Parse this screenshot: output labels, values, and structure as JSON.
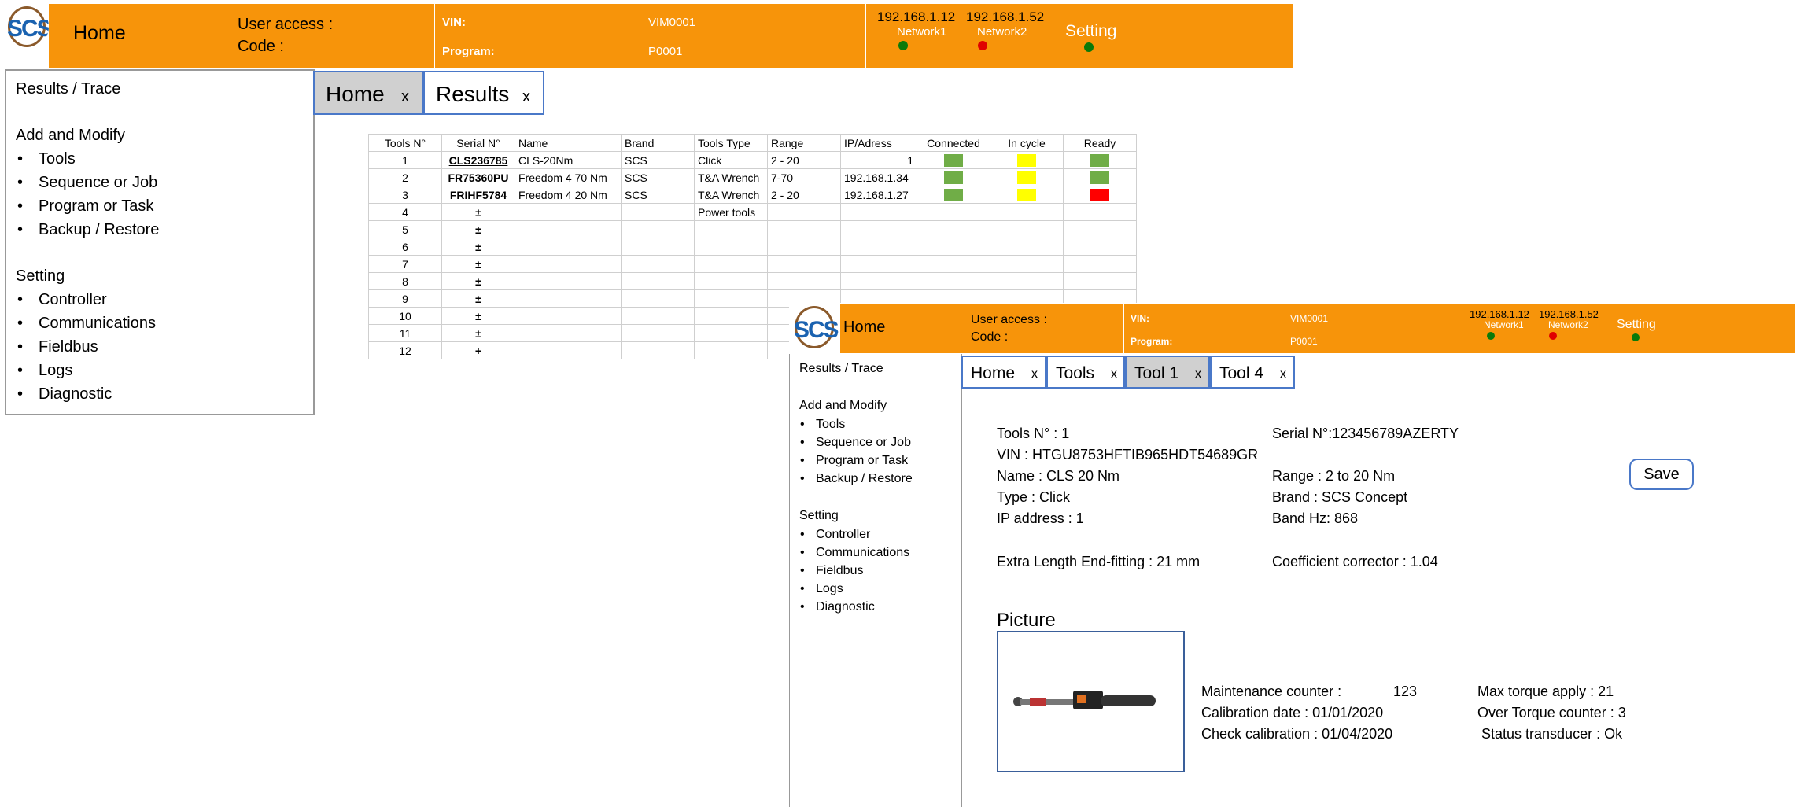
{
  "colors": {
    "header": "#F7940A",
    "green": "#70AD47",
    "yellow": "#FFFF00",
    "red": "#FF0000",
    "tab_border": "#4a78c8"
  },
  "main": {
    "logo_text": "SCS",
    "header": {
      "home": "Home",
      "user_access": "User access :",
      "code": "Code :",
      "vin_label": "VIN:",
      "vin_value": "VIM0001",
      "program_label": "Program:",
      "program_value": "P0001",
      "ip1": "192.168.1.12",
      "ip2": "192.168.1.52",
      "network1": "Network1",
      "network2": "Network2",
      "setting": "Setting"
    },
    "sidebar": {
      "results": "Results / Trace",
      "add_modify": "Add and Modify",
      "add_items": [
        "Tools",
        "Sequence or Job",
        "Program or Task",
        "Backup / Restore"
      ],
      "setting": "Setting",
      "setting_items": [
        "Controller",
        "Communications",
        "Fieldbus",
        "Logs",
        "Diagnostic"
      ]
    },
    "tabs": [
      {
        "label": "Home",
        "close": "x"
      },
      {
        "label": "Results",
        "close": "x"
      }
    ],
    "table": {
      "headers": [
        "Tools N°",
        "Serial N°",
        "Name",
        "Brand",
        "Tools Type",
        "Range",
        "IP/Adress",
        "Connected",
        "In cycle",
        "Ready"
      ],
      "rows": [
        {
          "no": "1",
          "serial": "CLS236785",
          "name": "CLS-20Nm",
          "brand": "SCS",
          "type": "Click",
          "range": "2 - 20",
          "ip": "1",
          "status": [
            "green",
            "yellow",
            "green"
          ]
        },
        {
          "no": "2",
          "serial": "FR75360PU",
          "name": "Freedom 4 70 Nm",
          "brand": "SCS",
          "type": "T&A Wrench",
          "range": "7-70",
          "ip": "192.168.1.34",
          "status": [
            "green",
            "yellow",
            "green"
          ]
        },
        {
          "no": "3",
          "serial": "FRIHF5784",
          "name": "Freedom 4 20 Nm",
          "brand": "SCS",
          "type": "T&A Wrench",
          "range": "2 - 20",
          "ip": "192.168.1.27",
          "status": [
            "green",
            "yellow",
            "red"
          ]
        }
      ],
      "empty_rows": [
        {
          "no": "4",
          "add": "±",
          "extra": "Power tools"
        },
        {
          "no": "5",
          "add": "±"
        },
        {
          "no": "6",
          "add": "±"
        },
        {
          "no": "7",
          "add": "±"
        },
        {
          "no": "8",
          "add": "±"
        },
        {
          "no": "9",
          "add": "±"
        },
        {
          "no": "10",
          "add": "±"
        },
        {
          "no": "11",
          "add": "±"
        },
        {
          "no": "12",
          "add": "+"
        }
      ]
    }
  },
  "detail": {
    "logo_text": "SCS",
    "header": {
      "home": "Home",
      "user_access": "User access :",
      "code": "Code :",
      "vin_label": "VIN:",
      "vin_value": "VIM0001",
      "program_label": "Program:",
      "program_value": "P0001",
      "ip1": "192.168.1.12",
      "ip2": "192.168.1.52",
      "network1": "Network1",
      "network2": "Network2",
      "setting": "Setting"
    },
    "sidebar": {
      "results": "Results / Trace",
      "add_modify": "Add and Modify",
      "add_items": [
        "Tools",
        "Sequence or Job",
        "Program or Task",
        "Backup / Restore"
      ],
      "setting": "Setting",
      "setting_items": [
        "Controller",
        "Communications",
        "Fieldbus",
        "Logs",
        "Diagnostic"
      ]
    },
    "tabs": [
      {
        "label": "Home",
        "close": "x"
      },
      {
        "label": "Tools",
        "close": "x"
      },
      {
        "label": "Tool 1",
        "close": "x"
      },
      {
        "label": "Tool 4",
        "close": "x"
      }
    ],
    "info": {
      "tools_no": "Tools N° : 1",
      "serial": "Serial N°:123456789AZERTY",
      "vin": "VIN : HTGU8753HFTIB965HDT54689GR",
      "name": "Name : CLS 20 Nm",
      "range": "Range : 2 to 20 Nm",
      "type": "Type : Click",
      "brand": "Brand : SCS Concept",
      "ip": "IP address : 1",
      "band": "Band Hz: 868",
      "extra_length": "Extra Length End-fitting : 21 mm",
      "coefficient": "Coefficient corrector : 1.04"
    },
    "save": "Save",
    "picture_title": "Picture",
    "counters": {
      "maintenance_label": "Maintenance counter :",
      "maintenance_value": "123",
      "calibration": "Calibration date : 01/01/2020",
      "check": "Check calibration : 01/04/2020",
      "max_torque": "Max torque apply : 21",
      "over_torque": "Over Torque counter : 3",
      "status": "Status transducer : Ok"
    }
  }
}
